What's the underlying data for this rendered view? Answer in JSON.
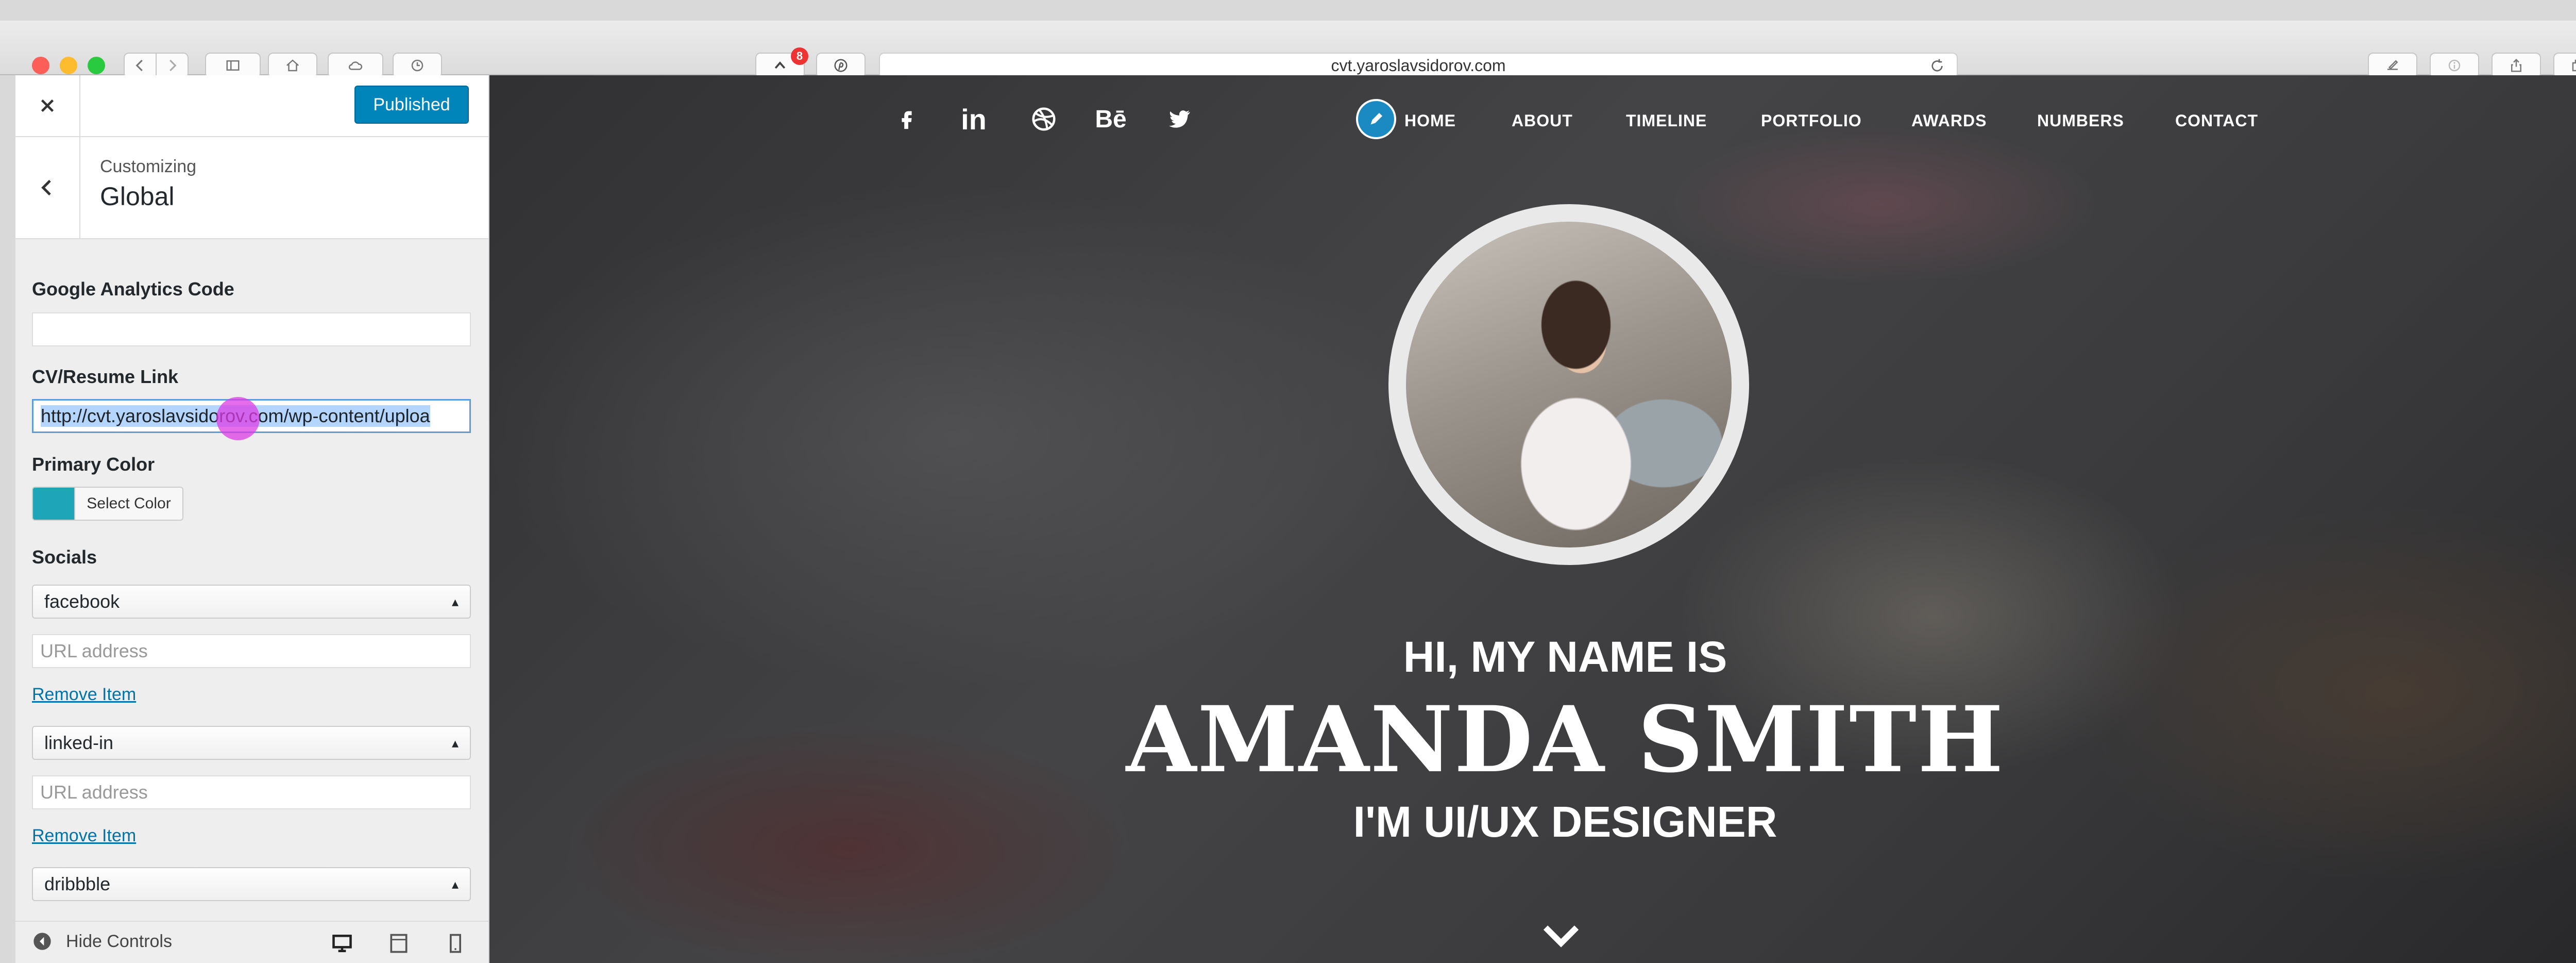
{
  "browser": {
    "url": "cvt.yaroslavsidorov.com",
    "notification_badge": "8"
  },
  "customizer": {
    "publish_label": "Published",
    "breadcrumb": "Customizing",
    "section_title": "Global",
    "fields": {
      "analytics_label": "Google Analytics Code",
      "analytics_value": "",
      "cv_label": "CV/Resume Link",
      "cv_value": "http://cvt.yaroslavsidorov.com/wp-content/uploa",
      "primary_color_label": "Primary Color",
      "primary_color_value": "#1fa5b8",
      "select_color_label": "Select Color",
      "socials_label": "Socials",
      "url_placeholder": "URL address",
      "remove_label": "Remove Item",
      "social_items": [
        "facebook",
        "linked-in",
        "dribbble"
      ]
    },
    "footer": {
      "hide_controls": "Hide Controls"
    }
  },
  "site": {
    "socials": [
      "facebook",
      "linkedin",
      "dribbble",
      "behance",
      "twitter"
    ],
    "behance_text": "Bē",
    "linkedin_text": "in",
    "nav": [
      "HOME",
      "ABOUT",
      "TIMELINE",
      "PORTFOLIO",
      "AWARDS",
      "NUMBERS",
      "CONTACT"
    ],
    "hero": {
      "greeting": "HI, MY NAME IS",
      "name": "AMANDA SMITH",
      "role": "I'M UI/UX DESIGNER"
    },
    "accent": "#1b8ac2"
  }
}
